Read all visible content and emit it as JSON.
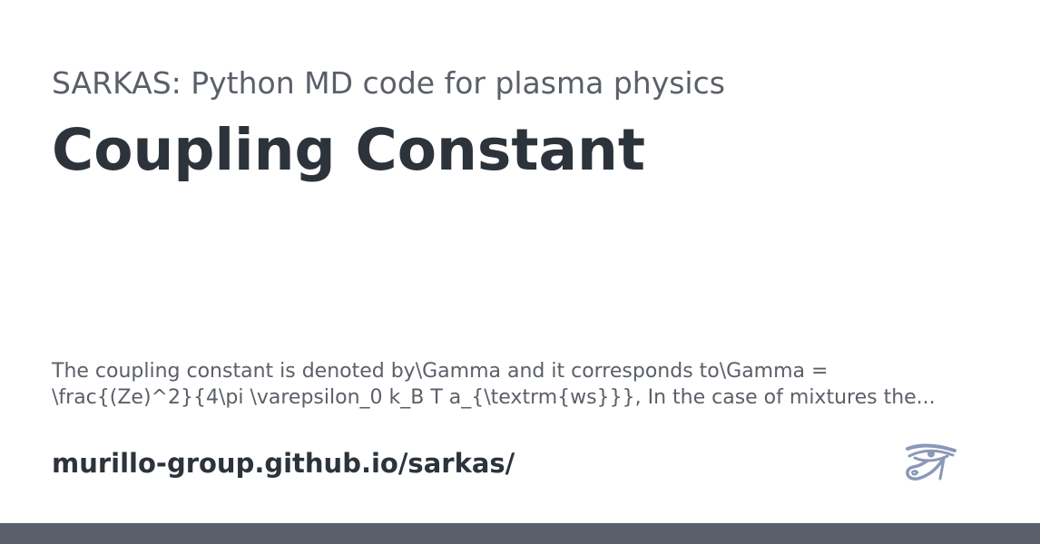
{
  "card": {
    "site_title": "SARKAS: Python MD code for plasma physics",
    "page_title": "Coupling Constant",
    "description": "The coupling constant is denoted by\\Gamma and it corresponds to\\Gamma = \\frac{(Ze)^2}{4\\pi \\varepsilon_0 k_B T a_{\\textrm{ws}}}, In the case of mixtures the...",
    "url": "murillo-group.github.io/sarkas/",
    "logo_icon": "eye-of-horus-icon",
    "colors": {
      "heading": "#2d333b",
      "muted_text": "#5a5f68",
      "logo": "#8a98b8",
      "bottom_bar": "#5a5f6b"
    }
  }
}
